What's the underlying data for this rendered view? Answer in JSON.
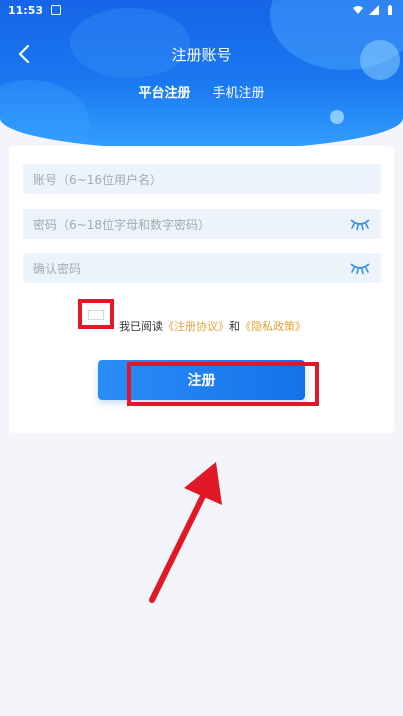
{
  "status_bar": {
    "time": "11:53"
  },
  "header": {
    "title": "注册账号",
    "tabs": [
      {
        "label": "平台注册",
        "active": true
      },
      {
        "label": "手机注册",
        "active": false
      }
    ]
  },
  "form": {
    "account_placeholder": "账号（6~16位用户名）",
    "password_placeholder": "密码（6~18位字母和数字密码）",
    "confirm_placeholder": "确认密码",
    "agreement_prefix": "我已阅读",
    "agreement_link1": "《注册协议》",
    "agreement_and": "和",
    "agreement_link2": "《隐私政策》",
    "register_label": "注册"
  },
  "colors": {
    "brand_blue": "#1a78f0",
    "link_orange": "#e5a33c",
    "highlight_red": "#e01827"
  }
}
